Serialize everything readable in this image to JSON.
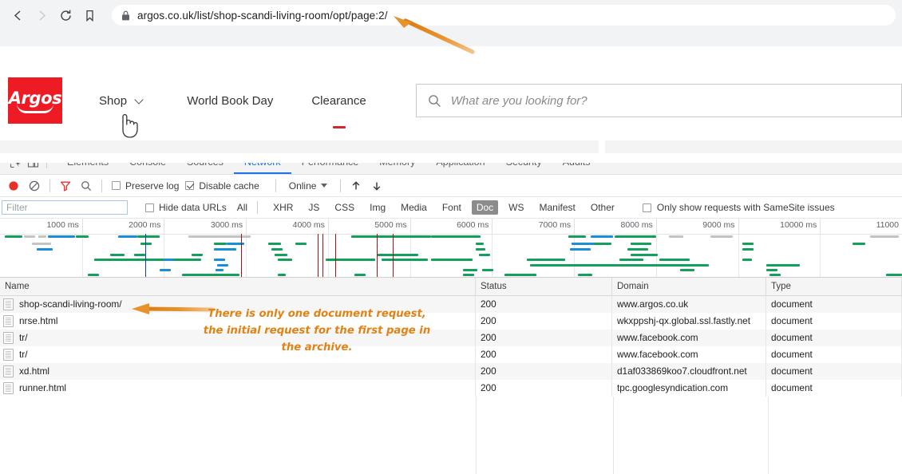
{
  "browser": {
    "back_icon": "back-arrow-icon",
    "forward_icon": "forward-arrow-icon",
    "reload_icon": "reload-icon",
    "bookmark_icon": "bookmark-icon",
    "lock_icon": "lock-icon",
    "url": "argos.co.uk/list/shop-scandi-living-room/opt/page:2/"
  },
  "site": {
    "logo_text": "Argos",
    "nav": [
      {
        "label": "Shop",
        "has_caret": true,
        "underline": false
      },
      {
        "label": "World Book Day",
        "has_caret": false,
        "underline": false
      },
      {
        "label": "Clearance",
        "has_caret": false,
        "underline": true
      }
    ],
    "search_placeholder": "What are you looking for?",
    "search_icon": "search-icon"
  },
  "devtools": {
    "inspect_icon": "inspect-element-icon",
    "device_icon": "device-toolbar-icon",
    "tabs": [
      {
        "label": "Elements",
        "active": false
      },
      {
        "label": "Console",
        "active": false
      },
      {
        "label": "Sources",
        "active": false
      },
      {
        "label": "Network",
        "active": true
      },
      {
        "label": "Performance",
        "active": false
      },
      {
        "label": "Memory",
        "active": false
      },
      {
        "label": "Application",
        "active": false
      },
      {
        "label": "Security",
        "active": false
      },
      {
        "label": "Audits",
        "active": false
      }
    ],
    "toolbar": {
      "record_icon": "record-stop-icon",
      "clear_icon": "clear-icon",
      "filter_icon": "filter-funnel-icon",
      "search_icon": "search-icon",
      "preserve_log_label": "Preserve log",
      "preserve_log_checked": false,
      "disable_cache_label": "Disable cache",
      "disable_cache_checked": true,
      "throttle_value": "Online",
      "import_icon": "import-har-icon",
      "export_icon": "export-har-icon"
    },
    "filterbar": {
      "filter_placeholder": "Filter",
      "hide_data_urls_label": "Hide data URLs",
      "hide_data_urls_checked": false,
      "types": [
        {
          "label": "All",
          "selected": false
        },
        {
          "label": "XHR",
          "selected": false
        },
        {
          "label": "JS",
          "selected": false
        },
        {
          "label": "CSS",
          "selected": false
        },
        {
          "label": "Img",
          "selected": false
        },
        {
          "label": "Media",
          "selected": false
        },
        {
          "label": "Font",
          "selected": false
        },
        {
          "label": "Doc",
          "selected": true
        },
        {
          "label": "WS",
          "selected": false
        },
        {
          "label": "Manifest",
          "selected": false
        },
        {
          "label": "Other",
          "selected": false
        }
      ],
      "samesite_label": "Only show requests with SameSite issues",
      "samesite_checked": false
    },
    "overview": {
      "ticks": [
        "1000 ms",
        "2000 ms",
        "3000 ms",
        "4000 ms",
        "5000 ms",
        "6000 ms",
        "7000 ms",
        "8000 ms",
        "9000 ms",
        "10000 ms",
        "11000"
      ],
      "colors": {
        "bar_green": "#12a05c",
        "bar_blue": "#1a8fd8",
        "bar_grey": "#c4c4c4",
        "bar_purple": "#9c27b0",
        "marker_dcl": "#0b4a8c",
        "marker_load": "#8e1b1b"
      }
    },
    "table": {
      "columns": [
        "Name",
        "Status",
        "Domain",
        "Type"
      ],
      "rows": [
        {
          "name": "shop-scandi-living-room/",
          "status": "200",
          "domain": "www.argos.co.uk",
          "type": "document"
        },
        {
          "name": "nrse.html",
          "status": "200",
          "domain": "wkxppshj-qx.global.ssl.fastly.net",
          "type": "document"
        },
        {
          "name": "tr/",
          "status": "200",
          "domain": "www.facebook.com",
          "type": "document"
        },
        {
          "name": "tr/",
          "status": "200",
          "domain": "www.facebook.com",
          "type": "document"
        },
        {
          "name": "xd.html",
          "status": "200",
          "domain": "d1af033869koo7.cloudfront.net",
          "type": "document"
        },
        {
          "name": "runner.html",
          "status": "200",
          "domain": "tpc.googlesyndication.com",
          "type": "document"
        }
      ]
    }
  },
  "annotations": {
    "accent_color": "#e08214",
    "note_line1": "There is only one document request,",
    "note_line2": "the initial request for the first page in",
    "note_line3": "the archive.",
    "arrow_url_icon": "arrow-pointing-to-url",
    "arrow_row_icon": "arrow-pointing-to-first-row"
  }
}
